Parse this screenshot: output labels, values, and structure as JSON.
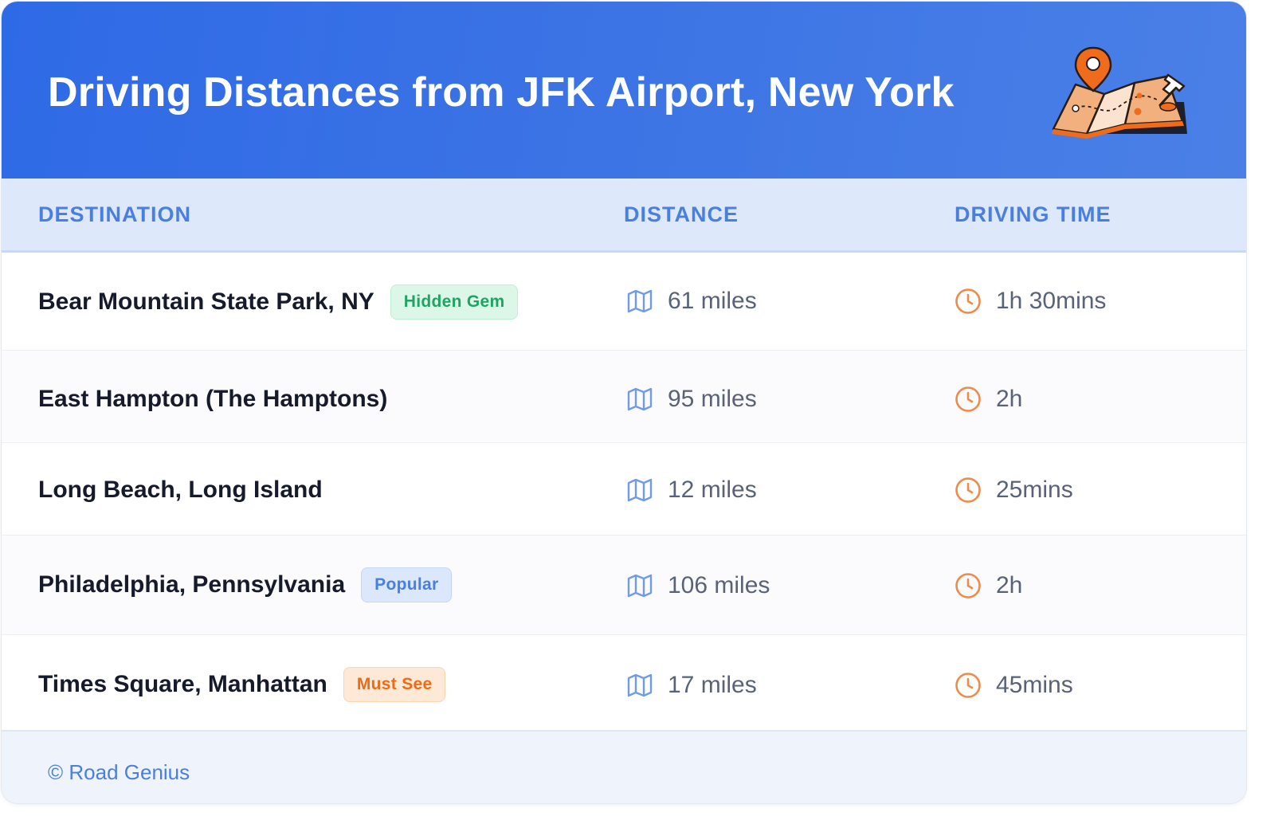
{
  "header": {
    "title": "Driving Distances from JFK Airport, New York",
    "illustration_icon": "folded-map-with-pins-icon",
    "gradient_colors": [
      "#2f6ae6",
      "#4a80e6"
    ]
  },
  "columns": {
    "destination": "DESTINATION",
    "distance": "DISTANCE",
    "driving_time": "DRIVING TIME"
  },
  "rows": [
    {
      "destination": "Bear Mountain State Park, NY",
      "badge": "Hidden Gem",
      "distance": "61 miles",
      "time": "1h 30mins"
    },
    {
      "destination": "East Hampton (The Hamptons)",
      "badge": "",
      "distance": "95 miles",
      "time": "2h"
    },
    {
      "destination": "Long Beach, Long Island",
      "badge": "",
      "distance": "12 miles",
      "time": "25mins"
    },
    {
      "destination": "Philadelphia, Pennsylvania",
      "badge": "Popular",
      "distance": "106 miles",
      "time": "2h"
    },
    {
      "destination": "Times Square, Manhattan",
      "badge": "Must See",
      "distance": "17 miles",
      "time": "45mins"
    }
  ],
  "icons": {
    "distance": "map-icon",
    "time": "clock-icon"
  },
  "colors": {
    "accent_blue": "#4a7fe0",
    "clock_orange": "#ee8a4a",
    "badge_hidden_gem": "#1fa463",
    "badge_popular": "#4a7fe0",
    "badge_must_see": "#ec6b18"
  },
  "footer": {
    "credit": "© Road Genius"
  }
}
